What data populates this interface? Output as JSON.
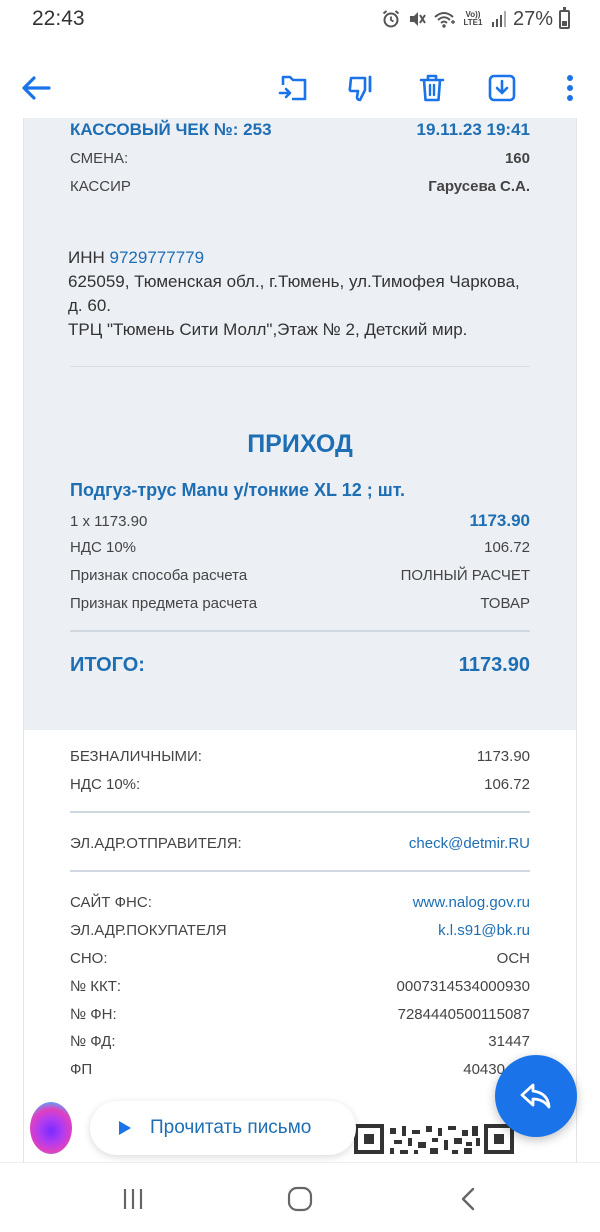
{
  "status_bar": {
    "time": "22:43",
    "network_label": "Vo)) LTE1",
    "battery": "27%",
    "battery_level": 0.27
  },
  "toolbar": {
    "icons": [
      "back-arrow-icon",
      "move-to-folder-icon",
      "thumbs-down-icon",
      "trash-icon",
      "download-icon",
      "more-vert-icon"
    ]
  },
  "receipt": {
    "header": {
      "title": "КАССОВЫЙ ЧЕК №: 253",
      "datetime": "19.11.23 19:41",
      "shift_label": "СМЕНА:",
      "shift_value": "160",
      "cashier_label": "КАССИР",
      "cashier_value": "Гарусева С.А."
    },
    "seller": {
      "inn_label": "ИНН",
      "inn_value": "9729777779",
      "address": "625059, Тюменская обл., г.Тюмень, ул.Тимофея Чаркова, д. 60.",
      "store": "ТРЦ \"Тюмень Сити Молл\",Этаж № 2, Детский мир."
    },
    "operation": "ПРИХОД",
    "item": {
      "name": "Подгуз-трус Manu у/тонкие XL 12 ; шт.",
      "qty_price": "1 x 1173.90",
      "sum": "1173.90",
      "vat_label": "НДС 10%",
      "vat_value": "106.72",
      "payment_method_label": "Признак способа расчета",
      "payment_method_value": "ПОЛНЫЙ РАСЧЕТ",
      "subject_label": "Признак предмета расчета",
      "subject_value": "ТОВАР"
    },
    "total_label": "ИТОГО:",
    "total_value": "1173.90",
    "payment": {
      "cashless_label": "БЕЗНАЛИЧНЫМИ:",
      "cashless_value": "1173.90",
      "vat_label": "НДС 10%:",
      "vat_value": "106.72"
    },
    "sender": {
      "label": "ЭЛ.АДР.ОТПРАВИТЕЛЯ:",
      "value": "check@detmir.RU"
    },
    "fiscal": {
      "fns_site_label": "САЙТ ФНС:",
      "fns_site_value": "www.nalog.gov.ru",
      "buyer_email_label": "ЭЛ.АДР.ПОКУПАТЕЛЯ",
      "buyer_email_value": "k.l.s91@bk.ru",
      "sno_label": "СНО:",
      "sno_value": "ОСН",
      "kkt_label": "№ ККТ:",
      "kkt_value": "0007314534000930",
      "fn_label": "№ ФН:",
      "fn_value": "7284440500115087",
      "fd_label": "№ ФД:",
      "fd_value": "31447",
      "fp_label": "ФП",
      "fp_value": "40430405"
    }
  },
  "floating": {
    "read_label": "Прочитать письмо"
  },
  "colors": {
    "accent": "#1e6eb4",
    "fab": "#1a73e8",
    "receipt_bg": "#eceff4"
  }
}
